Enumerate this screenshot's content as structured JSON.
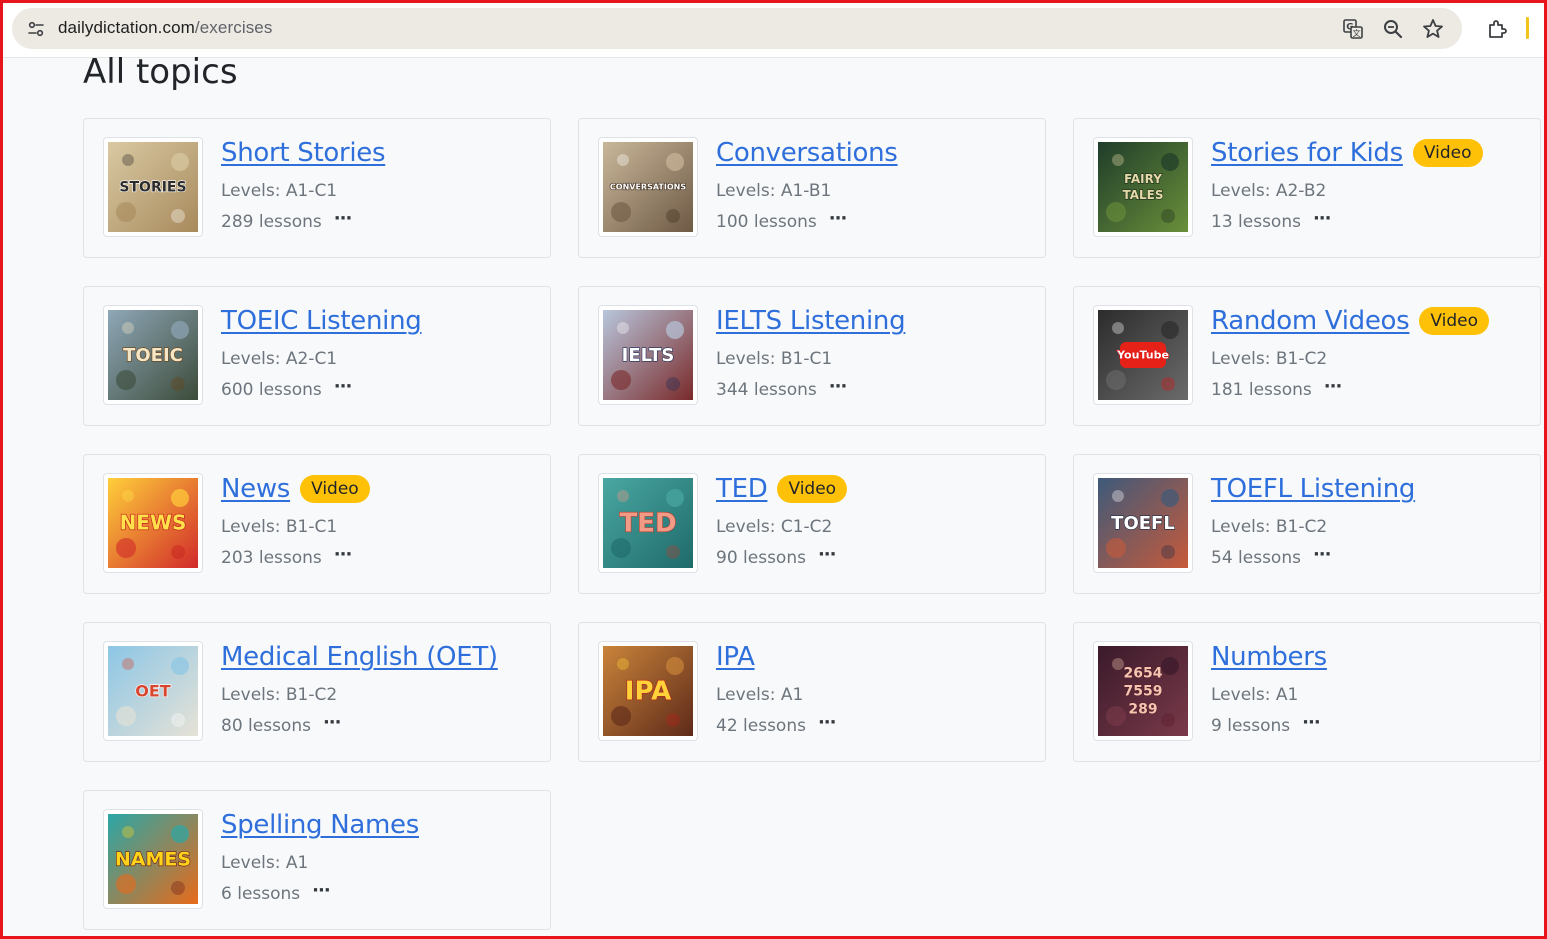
{
  "browser": {
    "url_host": "dailydictation.com",
    "url_path": "/exercises",
    "icons": [
      "site-settings-icon",
      "translate-icon",
      "zoom-icon",
      "bookmark-star-icon",
      "extensions-icon"
    ]
  },
  "page": {
    "heading": "All topics"
  },
  "colors": {
    "link": "#2f6fdb",
    "badge": "#ffc107",
    "muted_text": "#6c757d",
    "frame": "#e8141b"
  },
  "topics": [
    {
      "title": "Short Stories",
      "levels": "Levels: A1-C1",
      "lessons": "289 lessons",
      "badge": "",
      "thumb_text": "STORIES",
      "more": "···"
    },
    {
      "title": "Conversations",
      "levels": "Levels: A1-B1",
      "lessons": "100 lessons",
      "badge": "",
      "thumb_text": "CONVERSATIONS",
      "more": "···"
    },
    {
      "title": "Stories for Kids",
      "levels": "Levels: A2-B2",
      "lessons": "13 lessons",
      "badge": "Video",
      "thumb_text": "FAIRY TALES",
      "more": "···"
    },
    {
      "title": "TOEIC Listening",
      "levels": "Levels: A2-C1",
      "lessons": "600 lessons",
      "badge": "",
      "thumb_text": "TOEIC",
      "more": "···"
    },
    {
      "title": "IELTS Listening",
      "levels": "Levels: B1-C1",
      "lessons": "344 lessons",
      "badge": "",
      "thumb_text": "IELTS",
      "more": "···"
    },
    {
      "title": "Random Videos",
      "levels": "Levels: B1-C2",
      "lessons": "181 lessons",
      "badge": "Video",
      "thumb_text": "YouTube",
      "more": "···"
    },
    {
      "title": "News",
      "levels": "Levels: B1-C1",
      "lessons": "203 lessons",
      "badge": "Video",
      "thumb_text": "NEWS",
      "more": "···"
    },
    {
      "title": "TED",
      "levels": "Levels: C1-C2",
      "lessons": "90 lessons",
      "badge": "Video",
      "thumb_text": "TED",
      "more": "···"
    },
    {
      "title": "TOEFL Listening",
      "levels": "Levels: B1-C2",
      "lessons": "54 lessons",
      "badge": "",
      "thumb_text": "TOEFL",
      "more": "···"
    },
    {
      "title": "Medical English (OET)",
      "levels": "Levels: B1-C2",
      "lessons": "80 lessons",
      "badge": "",
      "thumb_text": "OET",
      "more": "···"
    },
    {
      "title": "IPA",
      "levels": "Levels: A1",
      "lessons": "42 lessons",
      "badge": "",
      "thumb_text": "IPA",
      "more": "···"
    },
    {
      "title": "Numbers",
      "levels": "Levels: A1",
      "lessons": "9 lessons",
      "badge": "",
      "thumb_text": "2654 7559 289",
      "more": "···"
    },
    {
      "title": "Spelling Names",
      "levels": "Levels: A1",
      "lessons": "6 lessons",
      "badge": "",
      "thumb_text": "NAMES",
      "more": "···"
    }
  ]
}
